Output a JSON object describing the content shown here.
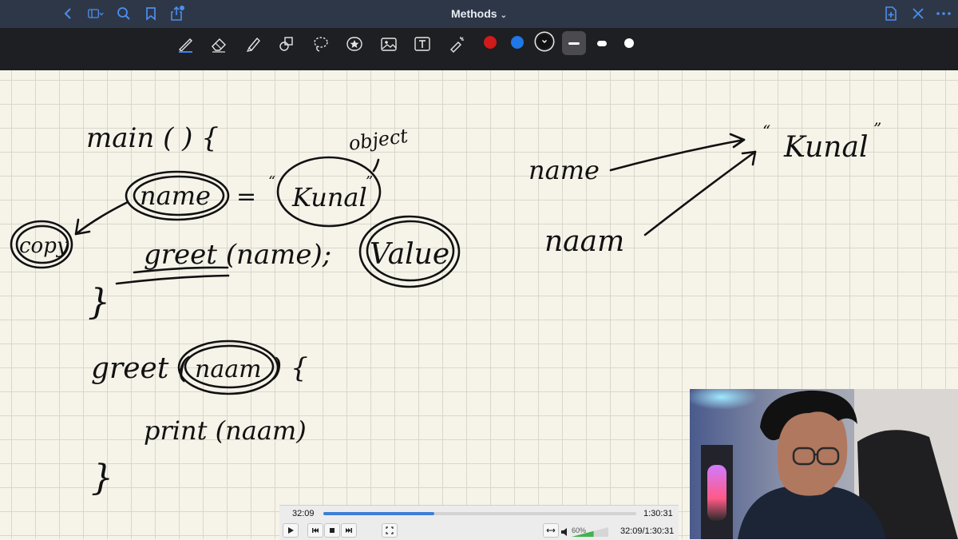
{
  "titlebar": {
    "title": "Methods",
    "icons": [
      "back-icon",
      "sidebar-icon",
      "search-icon",
      "bookmark-icon",
      "share-icon",
      "new-page-icon",
      "close-icon",
      "more-icon"
    ]
  },
  "toolbar": {
    "tools": [
      "pen-icon",
      "eraser-icon",
      "highlighter-icon",
      "shapes-icon",
      "lasso-icon",
      "sticker-icon",
      "image-icon",
      "text-icon",
      "laser-pointer-icon"
    ],
    "colors": [
      "#d11a1a",
      "#1f77e8",
      "#111111"
    ],
    "selected_color": "#111111"
  },
  "notes": {
    "line1": "main ( ) {",
    "object_label": "object",
    "value_string": "Kunal",
    "copy_label": "copy",
    "name_var": "name",
    "equals": "=",
    "call": "greet (name);",
    "value_label": "Value",
    "close_brace": "}",
    "greet_def": "greet (",
    "param": "naam",
    "greet_tail": ") {",
    "print_stmt": "print (naam)",
    "right_name": "name",
    "right_naam": "naam",
    "right_value": "Kunal"
  },
  "player": {
    "current_time": "32:09",
    "total_time": "1:30:31",
    "progress_fraction": 0.355,
    "volume_label": "60%",
    "time_readout": "32:09/1:30:31"
  }
}
